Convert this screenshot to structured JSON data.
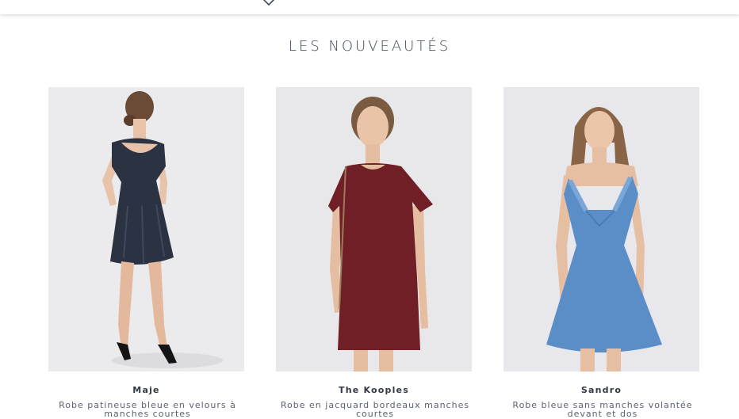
{
  "header": {
    "dropdown_icon": "chevron-down-icon"
  },
  "section": {
    "title": "LES NOUVEAUTÉS"
  },
  "products": [
    {
      "brand": "Maje",
      "description": "Robe patineuse bleue en velours à manches courtes",
      "dress_color": "#2b3342"
    },
    {
      "brand": "The Kooples",
      "description": "Robe en jacquard bordeaux manches courtes",
      "dress_color": "#6f1f25"
    },
    {
      "brand": "Sandro",
      "description": "Robe bleue sans manches volantée devant et dos",
      "dress_color": "#5b8ec7"
    }
  ]
}
